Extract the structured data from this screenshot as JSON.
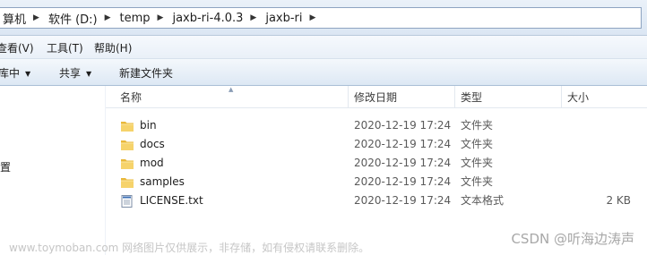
{
  "address": {
    "crumbs": [
      "算机",
      "软件 (D:)",
      "temp",
      "jaxb-ri-4.0.3",
      "jaxb-ri"
    ]
  },
  "menu": {
    "items": [
      "查看(V)",
      "工具(T)",
      "帮助(H)"
    ]
  },
  "toolbar": {
    "include_label": "库中",
    "share_label": "共享",
    "new_folder_label": "新建文件夹"
  },
  "nav": {
    "partial_item": "置"
  },
  "columns": {
    "name": "名称",
    "date": "修改日期",
    "type": "类型",
    "size": "大小"
  },
  "files": [
    {
      "name": "bin",
      "date": "2020-12-19 17:24",
      "type": "文件夹",
      "size": "",
      "icon": "folder-icon"
    },
    {
      "name": "docs",
      "date": "2020-12-19 17:24",
      "type": "文件夹",
      "size": "",
      "icon": "folder-icon"
    },
    {
      "name": "mod",
      "date": "2020-12-19 17:24",
      "type": "文件夹",
      "size": "",
      "icon": "folder-icon"
    },
    {
      "name": "samples",
      "date": "2020-12-19 17:24",
      "type": "文件夹",
      "size": "",
      "icon": "folder-icon"
    },
    {
      "name": "LICENSE.txt",
      "date": "2020-12-19 17:24",
      "type": "文本格式",
      "size": "2 KB",
      "icon": "text-file-icon"
    }
  ],
  "watermark": {
    "left": "www.toymoban.com 网络图片仅供展示，非存储，如有侵权请联系删除。",
    "right": "CSDN @听海边涛声"
  },
  "colors": {
    "folder": "#f2c74a",
    "chrome": "#dbe6f3"
  }
}
